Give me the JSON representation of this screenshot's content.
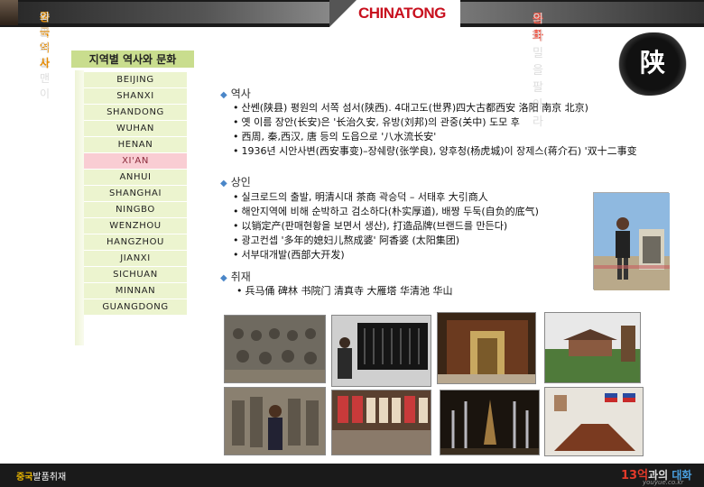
{
  "header": {
    "left_text_a": "비즈니스맨이 ",
    "left_text_hl": "꼭",
    "left_text_b": " 알아야할 ",
    "left_text_hl2": "중국역사",
    "left_text_c": "와 문화",
    "logo": "CHINATONG",
    "right_text_a": "중국",
    "right_text_b": "문화",
    "right_text_c": "의 비밀을 팔아라"
  },
  "sidebar": {
    "title": "지역별 역사와 문화",
    "items": [
      "BEIJING",
      "SHANXI",
      "SHANDONG",
      "WUHAN",
      "HENAN",
      "XI'AN",
      "ANHUI",
      "SHANGHAI",
      "NINGBO",
      "WENZHOU",
      "HANGZHOU",
      "JIANXI",
      "SICHUAN",
      "MINNAN",
      "GUANGDONG"
    ],
    "active": "XI'AN"
  },
  "badge": {
    "char": "陕"
  },
  "sections": {
    "history": {
      "title": "역사",
      "items": [
        "산쎈(陕县) 평원의 서쪽 섬서(陕西). 4대고도(世界)四大古都西安 洛阳 南京 北京)",
        "옛 이름 장안(长安)은 '长治久安, 유방(刘邦)의 관중(关中) 도모 후",
        "西周, 秦,西汉, 唐 등의 도읍으로 '八水流长安'",
        "1936년 시안사변(西安事变)–장쉐량(张学良), 양후청(杨虎城)이 장제스(蒋介石) '双十二事变"
      ]
    },
    "merchant": {
      "title": "상인",
      "items": [
        "실크로드의 출발, 明清시대 茶商 곽승덕 – 서태후 大引商人",
        "해안지역에 비해 순박하고 검소하다(朴实厚道), 배짱 두둑(自负的底气)",
        "以销定产(판매현황을 보면서 생산), 打造品牌(브랜드를 만든다)",
        "광고컨셉 '多年的媳妇儿熬成婆' 阿香婆 (太阳集团)",
        "서부대개발(西部大开发)"
      ]
    },
    "attractions": {
      "title": "취재",
      "items": [
        "兵马俑 碑林 书院门 清真寺 大雁塔 华清池 华山"
      ]
    }
  },
  "photos": [
    {
      "name": "terracotta-warriors-pit-photo"
    },
    {
      "name": "forest-of-steles-photo"
    },
    {
      "name": "mosque-hall-photo"
    },
    {
      "name": "temple-garden-photo"
    },
    {
      "name": "terracotta-visitors-photo"
    },
    {
      "name": "calligraphy-market-photo"
    },
    {
      "name": "fountain-pagoda-photo"
    },
    {
      "name": "conference-room-flags-photo"
    }
  ],
  "footer": {
    "left_a": "중국",
    "left_b": "발품취재",
    "right_a": "13억",
    "right_b": "과의 ",
    "right_c": "대화",
    "url": "youyue.co.kr"
  }
}
